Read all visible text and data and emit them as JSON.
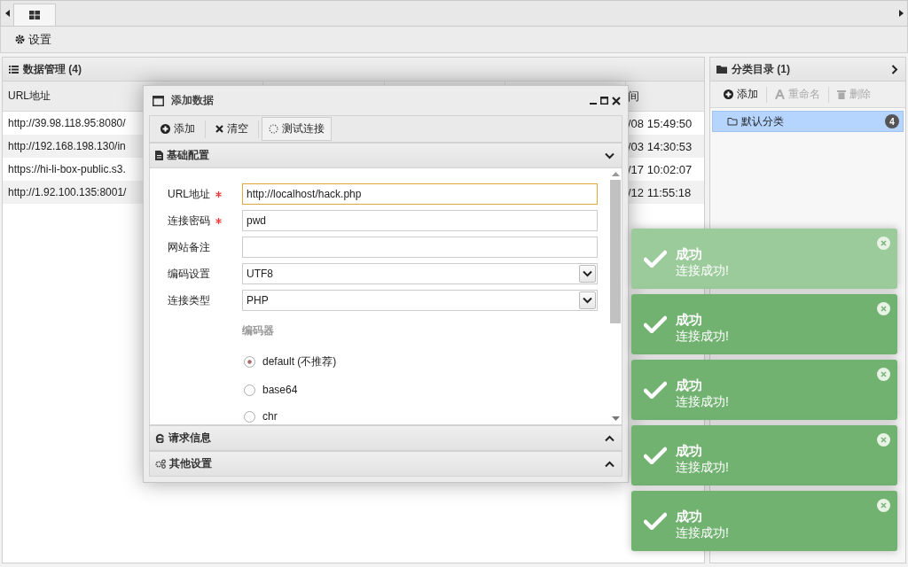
{
  "tabbar": {
    "tabs": [
      {
        "selected": true
      }
    ]
  },
  "toolbar": {
    "buttons": [
      {
        "label": "设置"
      }
    ]
  },
  "data_panel": {
    "title": "数据管理 (4)",
    "table": {
      "columns": [
        "URL地址",
        "间"
      ],
      "rows": [
        {
          "url": "http://39.98.118.95:8080/",
          "column_2": "/08 15:49:50"
        },
        {
          "url": "http://192.168.198.130/in",
          "column_2": "/03 14:30:53"
        },
        {
          "url": "https://hi-li-box-public.s3.",
          "column_2": "/17 10:02:07"
        },
        {
          "url": "http://1.92.100.135:8001/",
          "column_2": "/12 11:55:18"
        }
      ]
    }
  },
  "category_panel": {
    "title": "分类目录 (1)",
    "buttons": [
      {
        "label": "添加",
        "disabled": false
      },
      {
        "label": "重命名",
        "disabled": true
      },
      {
        "label": "删除",
        "disabled": true
      }
    ],
    "items": [
      {
        "label": "默认分类",
        "count": "4",
        "selected": true
      }
    ]
  },
  "dialog": {
    "title": "添加数据",
    "buttons": [
      {
        "label": "添加",
        "hovered": false
      },
      {
        "label": "清空",
        "hovered": false
      },
      {
        "label": "测试连接",
        "hovered": true
      }
    ],
    "sections": [
      {
        "title": "基础配置",
        "expanded": true
      },
      {
        "title": "请求信息",
        "expanded": false
      },
      {
        "title": "其他设置",
        "expanded": false
      }
    ],
    "fields": [
      {
        "kind": "text",
        "label": "URL地址",
        "required": true,
        "value": "http://localhost/hack.php",
        "focused": true
      },
      {
        "kind": "text",
        "label": "连接密码",
        "required": true,
        "value": "pwd",
        "focused": false
      },
      {
        "kind": "text",
        "label": "网站备注",
        "required": false,
        "focused": false
      },
      {
        "kind": "select",
        "label": "编码设置",
        "required": false,
        "value": "UTF8",
        "focused": false
      },
      {
        "kind": "select",
        "label": "连接类型",
        "required": false,
        "value": "PHP",
        "focused": false
      }
    ],
    "encoder": {
      "label": "编码器",
      "options": [
        {
          "label": "default (不推荐)",
          "selected": true
        },
        {
          "label": "base64",
          "selected": false
        },
        {
          "label": "chr",
          "selected": false
        }
      ]
    }
  },
  "toasts": [
    {
      "title": "成功",
      "message": "连接成功!",
      "faded": true
    },
    {
      "title": "成功",
      "message": "连接成功!",
      "faded": false
    },
    {
      "title": "成功",
      "message": "连接成功!",
      "faded": false
    },
    {
      "title": "成功",
      "message": "连接成功!",
      "faded": false
    },
    {
      "title": "成功",
      "message": "连接成功!",
      "faded": false
    }
  ]
}
